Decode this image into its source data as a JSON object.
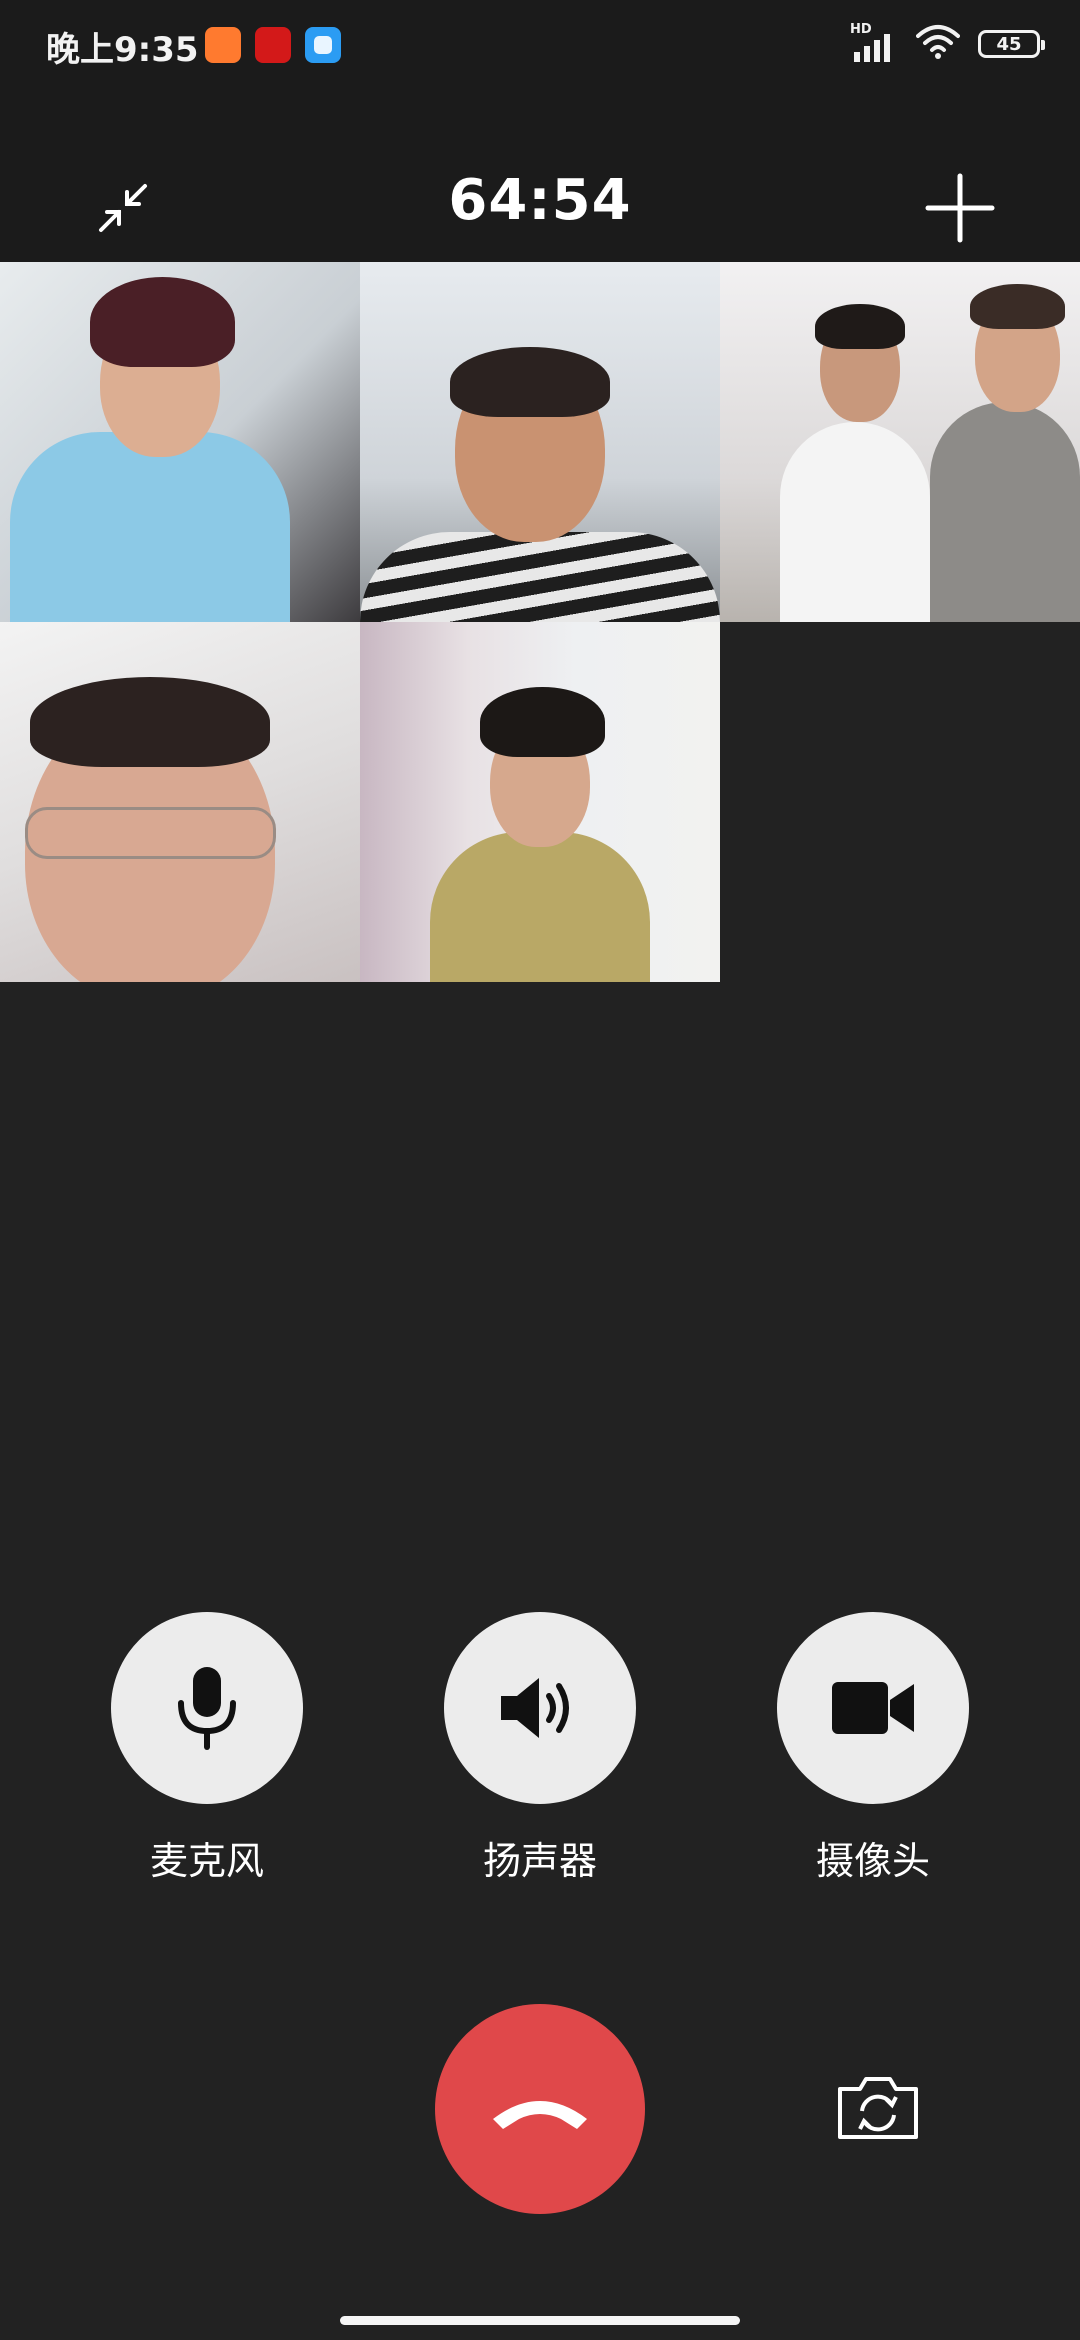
{
  "status_bar": {
    "time": "晚上9:35",
    "network_label": "HD",
    "battery_level": "45",
    "notification_icons": [
      "orange-app-icon",
      "red-app-icon",
      "blue-app-icon"
    ]
  },
  "call": {
    "timer": "64:54",
    "participant_count": 5
  },
  "controls": {
    "microphone_label": "麦克风",
    "speaker_label": "扬声器",
    "camera_label": "摄像头"
  },
  "colors": {
    "background": "#222222",
    "control_circle": "#ececec",
    "hangup": "#e0484a"
  }
}
